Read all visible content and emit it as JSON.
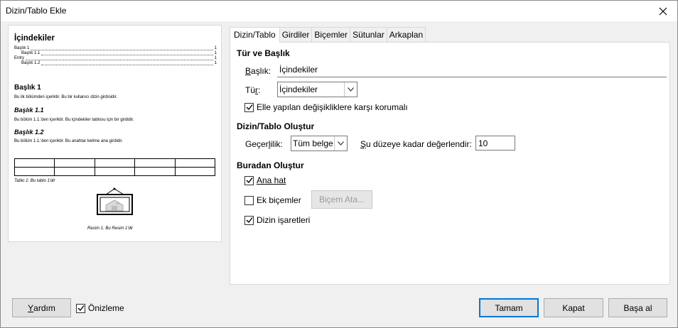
{
  "window": {
    "title": "Dizin/Tablo Ekle"
  },
  "preview": {
    "toc_title": "İçindekiler",
    "toc_entries": [
      {
        "label": "Başlık 1",
        "page": "1",
        "level": 1
      },
      {
        "label": "Başlık 1.1",
        "page": "1",
        "level": 2
      },
      {
        "label": "Entry",
        "page": "1",
        "level": 1
      },
      {
        "label": "Başlık 1.2",
        "page": "1",
        "level": 2
      }
    ],
    "h1": "Başlık 1",
    "p1": "Bu ilk bölümden içeriktir. Bu bir kullanıcı dizin girdisidir.",
    "h11": "Başlık 1.1",
    "p11": "Bu bölüm 1.1.'den içeriktir. Bu içindekiler tablosu için bir girdidir.",
    "h12": "Başlık 1.2",
    "p12": "Bu bölüm 1.1.'den içeriktir. Bu anahtar kelime ana girdidir.",
    "table_caption": "Tablo 1: Bu tablo 1'dir",
    "picture_caption": "Resim 1: Bu Resim 1'dir"
  },
  "tabs": [
    {
      "label": "Dizin/Tablo",
      "active": true
    },
    {
      "label": "Girdiler",
      "active": false
    },
    {
      "label": "Biçemler",
      "active": false
    },
    {
      "label": "Sütunlar",
      "active": false
    },
    {
      "label": "Arkaplan",
      "active": false
    }
  ],
  "type_title": {
    "heading": "Tür ve Başlık",
    "title_label": "Başlık:",
    "title_value": "İçindekiler",
    "type_label": "Tür:",
    "type_value": "İçindekiler",
    "protect_label": "Elle yapılan değişikliklere karşı korumalı",
    "protect_checked": true
  },
  "create_index": {
    "heading": "Dizin/Tablo Oluştur",
    "scope_label": "Geçerlilik:",
    "scope_value": "Tüm belge",
    "eval_label": "Şu düzeye kadar değerlendir:",
    "eval_value": "10"
  },
  "create_from": {
    "heading": "Buradan Oluştur",
    "outline_label": "Ana hat",
    "outline_checked": true,
    "additional_label": "Ek biçemler",
    "additional_checked": false,
    "assign_button": "Biçem Ata...",
    "index_marks_label": "Dizin işaretleri",
    "index_marks_checked": true
  },
  "footer": {
    "help": "Yardım",
    "preview_label": "Önizleme",
    "preview_checked": true,
    "ok": "Tamam",
    "close": "Kapat",
    "reset": "Başa al"
  }
}
